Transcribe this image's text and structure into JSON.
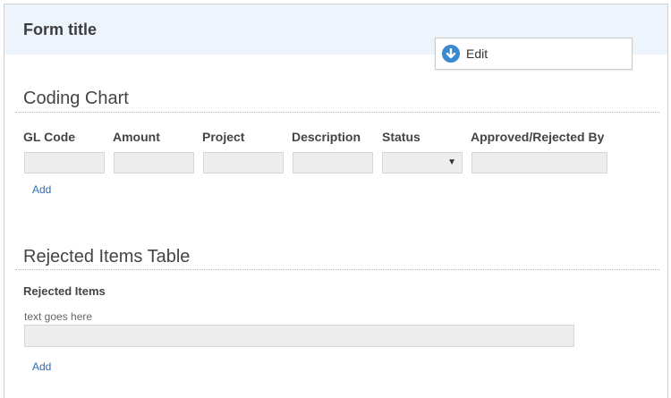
{
  "form": {
    "title": "Form title",
    "edit_label": "Edit"
  },
  "coding_chart": {
    "title": "Coding Chart",
    "columns": [
      "GL Code",
      "Amount",
      "Project",
      "Description",
      "Status",
      "Approved/Rejected By"
    ],
    "values": [
      "",
      "",
      "",
      "",
      "",
      ""
    ],
    "status_value": "",
    "add_label": "Add"
  },
  "rejected_items": {
    "section_title": "Rejected Items Table",
    "field_label": "Rejected Items",
    "hint": "text goes here",
    "value": "",
    "add_label": "Add"
  },
  "icons": {
    "edit": "arrow-down-circle-icon",
    "select": "caret-down-icon"
  },
  "colors": {
    "header_bg": "#eef4fb",
    "accent": "#3a88d0",
    "link": "#2a6bbf",
    "field_bg": "#ededed"
  }
}
